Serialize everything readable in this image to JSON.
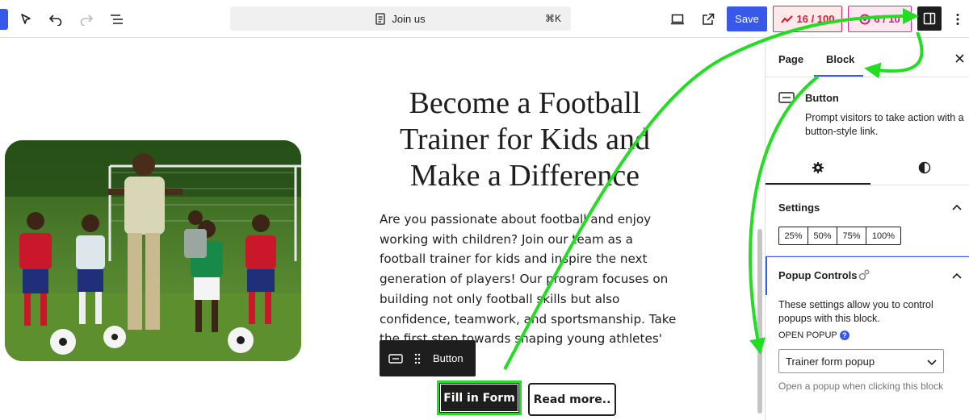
{
  "topbar": {
    "command": {
      "label": "Join us",
      "shortcut": "⌘K"
    },
    "save_label": "Save",
    "seo_score": "16 / 100",
    "readability_score": "6 / 10"
  },
  "content": {
    "heading": "Become a Football Trainer for Kids and Make a Difference",
    "paragraph": "Are you passionate about football and enjoy working with children? Join our team as a football trainer for kids and inspire the next generation of players! Our program focuses on building not only football skills but also confidence, teamwork, and sportsmanship. Take the first step towards shaping young athletes'",
    "block_toolbar_label": "Button",
    "primary_button": "Fill in Form",
    "secondary_button": "Read more.."
  },
  "sidebar": {
    "tabs": [
      {
        "label": "Page"
      },
      {
        "label": "Block"
      }
    ],
    "active_tab": "Block",
    "block": {
      "title": "Button",
      "description": "Prompt visitors to take action with a button-style link."
    },
    "settings": {
      "title": "Settings",
      "widths": [
        "25%",
        "50%",
        "75%",
        "100%"
      ]
    },
    "popup_controls": {
      "title": "Popup Controls",
      "description": "These settings allow you to control popups with this block.",
      "open_popup_label": "OPEN POPUP",
      "selected_popup": "Trainer form popup",
      "help_text": "Open a popup when clicking this block"
    }
  },
  "colors": {
    "accent": "#3858e9",
    "annotation_green": "#22dd22",
    "seo_red": "#d41d3a",
    "readability_pink": "#d1207b"
  }
}
